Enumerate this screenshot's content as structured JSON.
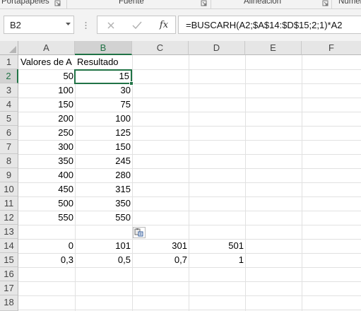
{
  "ribbon": {
    "groups": [
      {
        "label": "Portapapeles"
      },
      {
        "label": "Fuente"
      },
      {
        "label": "Alineación"
      },
      {
        "label": "Númer"
      }
    ]
  },
  "formula_bar": {
    "name_box": "B2",
    "fx_label": "fx",
    "formula": "=BUSCARH(A2;$A$14:$D$15;2;1)*A2"
  },
  "columns": [
    "A",
    "B",
    "C",
    "D",
    "E",
    "F"
  ],
  "rows": [
    "1",
    "2",
    "3",
    "4",
    "5",
    "6",
    "7",
    "8",
    "9",
    "10",
    "11",
    "12",
    "13",
    "14",
    "15",
    "16",
    "17",
    "18"
  ],
  "cells": {
    "A1": "Valores de A",
    "B1": "Resultado",
    "A2": "50",
    "B2": "15",
    "A3": "100",
    "B3": "30",
    "A4": "150",
    "B4": "75",
    "A5": "200",
    "B5": "100",
    "A6": "250",
    "B6": "125",
    "A7": "300",
    "B7": "150",
    "A8": "350",
    "B8": "245",
    "A9": "400",
    "B9": "280",
    "A10": "450",
    "B10": "315",
    "A11": "500",
    "B11": "350",
    "A12": "550",
    "B12": "550",
    "A14": "0",
    "B14": "101",
    "C14": "301",
    "D14": "501",
    "A15": "0,3",
    "B15": "0,5",
    "C15": "0,7",
    "D15": "1"
  },
  "selection": {
    "active_cell": "B2",
    "column": "B",
    "row": "2"
  },
  "colors": {
    "accent": "#217346",
    "grid": "#e1e1e1",
    "header_bg": "#e6e6e6"
  }
}
